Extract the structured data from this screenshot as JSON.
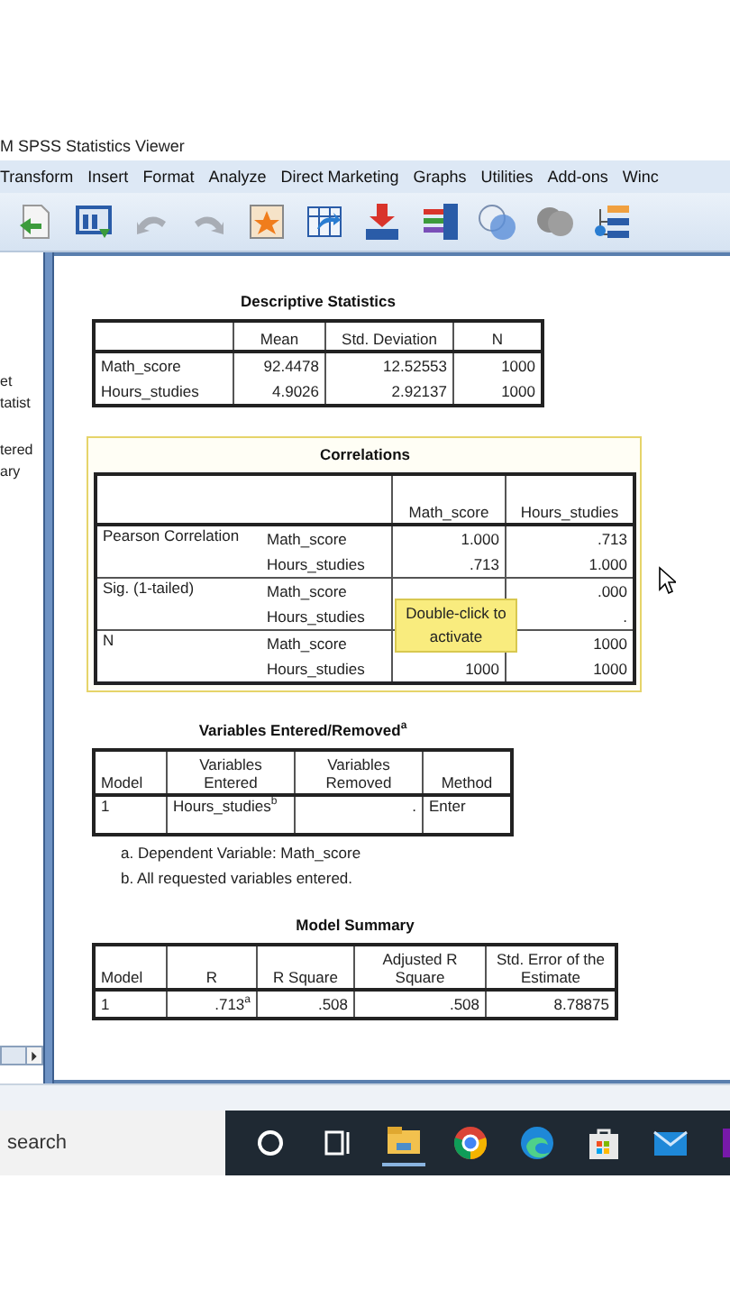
{
  "window": {
    "title": "M SPSS Statistics Viewer"
  },
  "menu": [
    "Transform",
    "Insert",
    "Format",
    "Analyze",
    "Direct Marketing",
    "Graphs",
    "Utilities",
    "Add-ons",
    "Winc"
  ],
  "outline": [
    "et",
    "tatist",
    "tered",
    "ary"
  ],
  "tables": [
    {
      "kind": "descriptives",
      "title": "Descriptive Statistics",
      "columns": [
        "",
        "Mean",
        "Std. Deviation",
        "N"
      ],
      "rows": [
        [
          "Math_score",
          "92.4478",
          "12.52553",
          "1000"
        ],
        [
          "Hours_studies",
          "4.9026",
          "2.92137",
          "1000"
        ]
      ]
    },
    {
      "kind": "correlations",
      "title": "Correlations",
      "selected": true,
      "columns": [
        "",
        "",
        "Math_score",
        "Hours_studies"
      ],
      "groups": [
        {
          "label": "Pearson Correlation",
          "rows": [
            {
              "variable": "Math_score",
              "math_score": "1.000",
              "hours_studies": ".713"
            },
            {
              "variable": "Hours_studies",
              "math_score": ".713",
              "hours_studies": "1.000"
            }
          ]
        },
        {
          "label": "Sig. (1-tailed)",
          "rows": [
            {
              "variable": "Math_score",
              "hours_studies": ".000"
            },
            {
              "variable": "Hours_studies",
              "hours_studies": "."
            }
          ]
        },
        {
          "label": "N",
          "rows": [
            {
              "variable": "Math_score",
              "hours_studies": "1000"
            },
            {
              "variable": "Hours_studies",
              "math_score": "1000",
              "hours_studies": "1000"
            }
          ]
        }
      ],
      "tooltip": "Double-click to activate"
    },
    {
      "kind": "variables",
      "title": "Variables Entered/Removed$^{a}$",
      "columns": [
        "Model",
        "Variables Entered",
        "Variables Removed",
        "Method"
      ],
      "rows": [
        [
          "1",
          "Hours_studies$^{b}$",
          ".",
          "Enter"
        ]
      ],
      "footnotes": [
        "a. Dependent Variable: Math_score",
        "b. All requested variables entered."
      ]
    },
    {
      "kind": "model_summary",
      "title": "Model Summary",
      "columns": [
        "Model",
        "R",
        "R Square",
        "Adjusted R Square",
        "Std. Error of the Estimate"
      ],
      "rows": [
        [
          "1",
          ".713$^{a}$",
          ".508",
          ".508",
          "8.78875"
        ]
      ]
    }
  ],
  "taskbar": {
    "search": {
      "placeholder": "search"
    }
  }
}
